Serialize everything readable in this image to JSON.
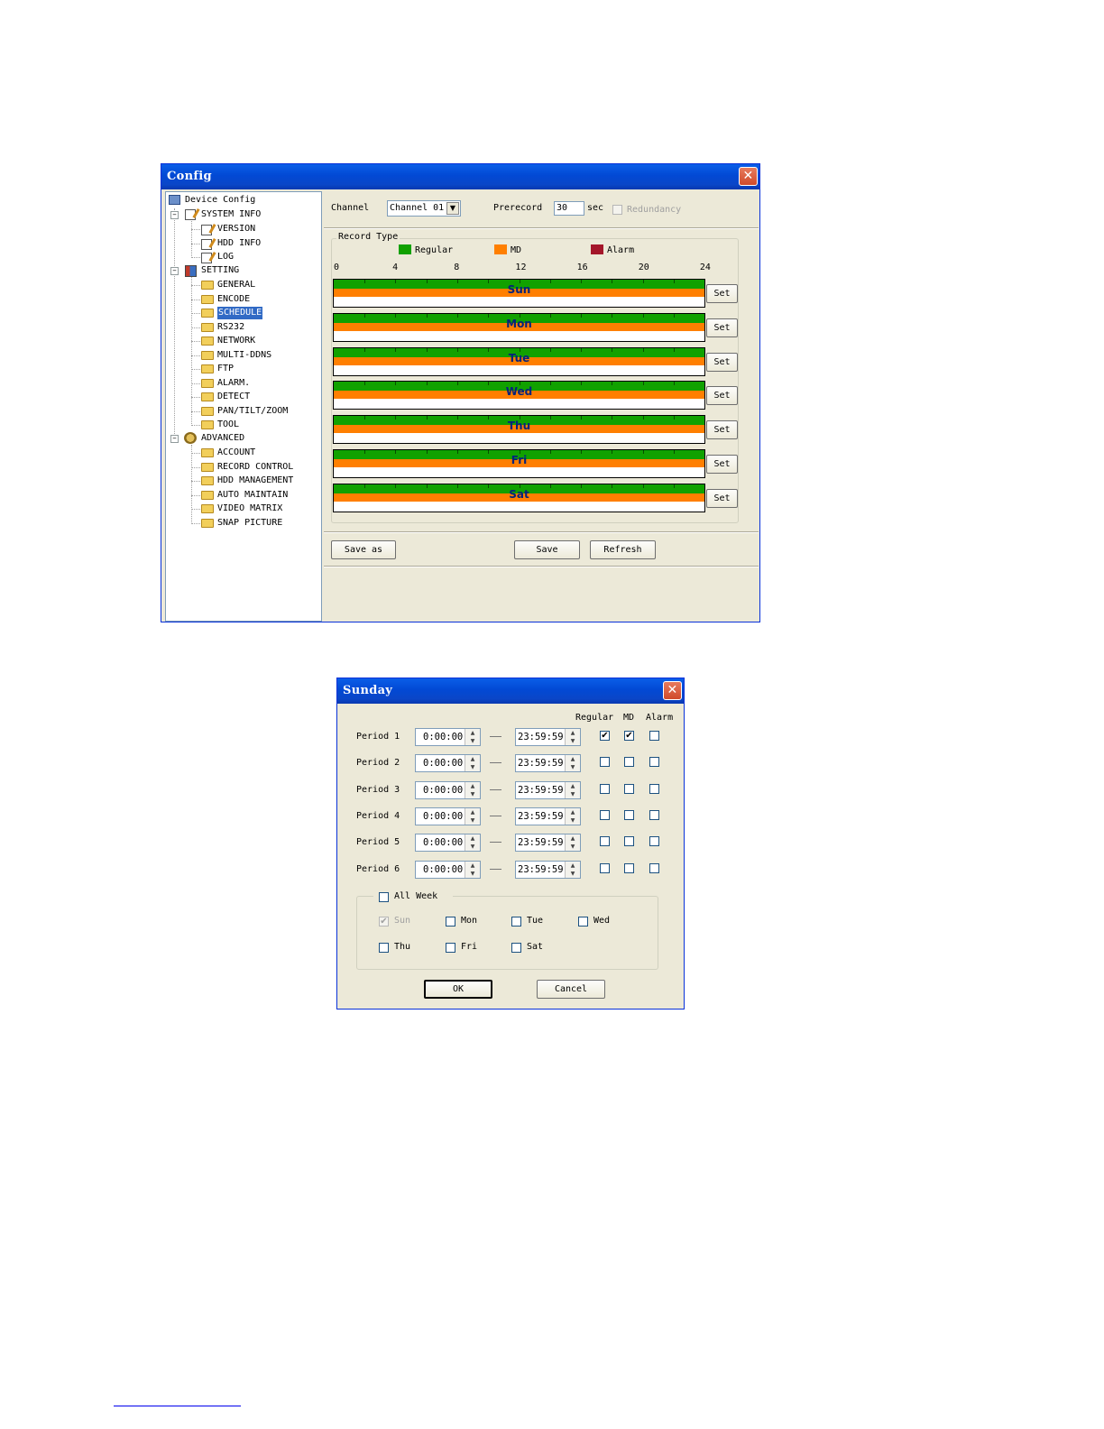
{
  "config": {
    "title": "Config",
    "tree": {
      "root": "Device Config",
      "system_info": {
        "label": "SYSTEM INFO",
        "children": [
          "VERSION",
          "HDD INFO",
          "LOG"
        ]
      },
      "setting": {
        "label": "SETTING",
        "children": [
          "GENERAL",
          "ENCODE",
          "SCHEDULE",
          "RS232",
          "NETWORK",
          "MULTI-DDNS",
          "FTP",
          "ALARM.",
          "DETECT",
          "PAN/TILT/ZOOM",
          "TOOL"
        ]
      },
      "advanced": {
        "label": "ADVANCED",
        "children": [
          "ACCOUNT",
          "RECORD CONTROL",
          "HDD MANAGEMENT",
          "AUTO MAINTAIN",
          "VIDEO MATRIX",
          "SNAP PICTURE"
        ]
      },
      "selected": "SCHEDULE"
    },
    "channel_label": "Channel",
    "channel_value": "Channel 01",
    "prerecord_label": "Prerecord",
    "prerecord_value": "30",
    "prerecord_unit": "sec",
    "redundancy_label": "Redundancy",
    "record_type_title": "Record Type",
    "legend": [
      {
        "name": "Regular",
        "color": "#11a100"
      },
      {
        "name": "MD",
        "color": "#ff7f00"
      },
      {
        "name": "Alarm",
        "color": "#a4162a"
      }
    ],
    "hour_ticks": [
      "0",
      "4",
      "8",
      "12",
      "16",
      "20",
      "24"
    ],
    "days": [
      {
        "name": "Sun",
        "set_label": "Set"
      },
      {
        "name": "Mon",
        "set_label": "Set"
      },
      {
        "name": "Tue",
        "set_label": "Set"
      },
      {
        "name": "Wed",
        "set_label": "Set"
      },
      {
        "name": "Thu",
        "set_label": "Set"
      },
      {
        "name": "Fri",
        "set_label": "Set"
      },
      {
        "name": "Sat",
        "set_label": "Set"
      }
    ],
    "buttons": {
      "save_as": "Save as",
      "save": "Save",
      "refresh": "Refresh"
    }
  },
  "sunday": {
    "title": "Sunday",
    "columns": {
      "regular": "Regular",
      "md": "MD",
      "alarm": "Alarm"
    },
    "periods": [
      {
        "label": "Period 1",
        "start": "0:00:00",
        "end": "23:59:59",
        "regular": true,
        "md": true,
        "alarm": false
      },
      {
        "label": "Period 2",
        "start": "0:00:00",
        "end": "23:59:59",
        "regular": false,
        "md": false,
        "alarm": false
      },
      {
        "label": "Period 3",
        "start": "0:00:00",
        "end": "23:59:59",
        "regular": false,
        "md": false,
        "alarm": false
      },
      {
        "label": "Period 4",
        "start": "0:00:00",
        "end": "23:59:59",
        "regular": false,
        "md": false,
        "alarm": false
      },
      {
        "label": "Period 5",
        "start": "0:00:00",
        "end": "23:59:59",
        "regular": false,
        "md": false,
        "alarm": false
      },
      {
        "label": "Period 6",
        "start": "0:00:00",
        "end": "23:59:59",
        "regular": false,
        "md": false,
        "alarm": false
      }
    ],
    "all_week_label": "All Week",
    "weekdays": [
      {
        "label": "Sun",
        "checked": true,
        "disabled": true
      },
      {
        "label": "Mon",
        "checked": false,
        "disabled": false
      },
      {
        "label": "Tue",
        "checked": false,
        "disabled": false
      },
      {
        "label": "Wed",
        "checked": false,
        "disabled": false
      },
      {
        "label": "Thu",
        "checked": false,
        "disabled": false
      },
      {
        "label": "Fri",
        "checked": false,
        "disabled": false
      },
      {
        "label": "Sat",
        "checked": false,
        "disabled": false
      }
    ],
    "ok_label": "OK",
    "cancel_label": "Cancel"
  }
}
